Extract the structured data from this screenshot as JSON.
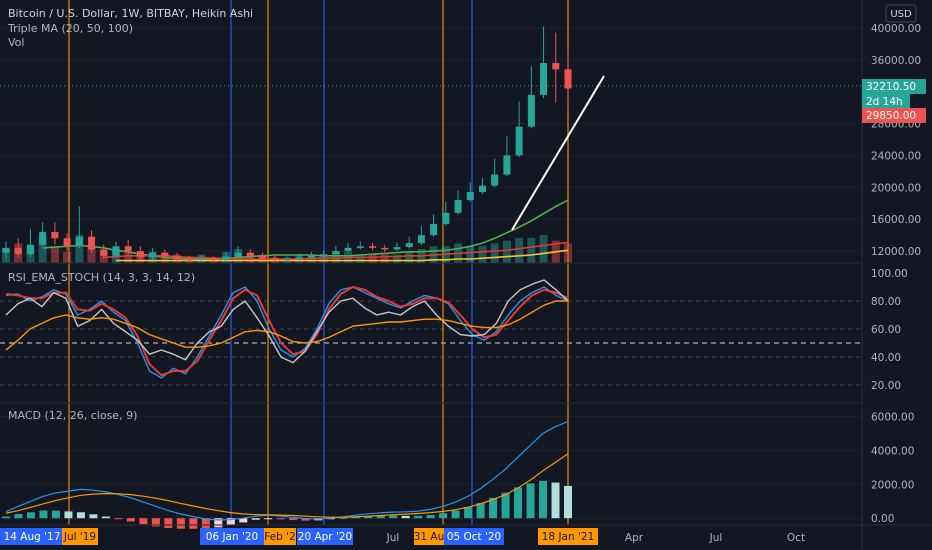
{
  "header": {
    "symbol_title": "Bitcoin / U.S. Dollar, 1W, BITBAY, Heikin Ashi",
    "indicator_ma": "Triple MA (20, 50, 100)",
    "indicator_vol": "Vol",
    "currency": "USD"
  },
  "price_axis": {
    "ticks": [
      "40000.00",
      "36000.00",
      "28000.00",
      "24000.00",
      "20000.00",
      "16000.00",
      "12000.00"
    ],
    "last_price": "32210.50",
    "countdown": "2d 14h",
    "low_marker": "29850.00"
  },
  "rsi_panel": {
    "title": "RSI_EMA_STOCH (14, 3, 3, 14, 12)",
    "ticks": [
      "100.00",
      "80.00",
      "60.00",
      "40.00",
      "20.00"
    ]
  },
  "macd_panel": {
    "title": "MACD (12, 26, close, 9)",
    "ticks": [
      "6000.00",
      "4000.00",
      "2000.00",
      "0.00"
    ]
  },
  "time_axis": {
    "plain_labels": [
      "Jul",
      "Apr",
      "Jul",
      "Oct"
    ],
    "markers": [
      {
        "label": "14 Aug '17",
        "color": "#2962ff"
      },
      {
        "label": "Jul '19",
        "color": "#ff9800"
      },
      {
        "label": "06 Jan '20",
        "color": "#2962ff"
      },
      {
        "label": "Feb '2",
        "color": "#ff9800"
      },
      {
        "label": "20 Apr '20",
        "color": "#2962ff"
      },
      {
        "label": "31 Au",
        "color": "#ff9800"
      },
      {
        "label": "05 Oct '20",
        "color": "#2962ff"
      },
      {
        "label": "18 Jan '21",
        "color": "#ff9800"
      }
    ]
  },
  "colors": {
    "background": "#131722",
    "grid": "#1e222d",
    "up": "#26a69a",
    "down": "#ef5350",
    "orange_marker": "#ff9800",
    "blue_marker": "#2962ff",
    "ma20": "#4caf50",
    "ma50": "#e53935",
    "ma100": "#fbc02d"
  },
  "chart_data": {
    "type": "line",
    "title": "Bitcoin / U.S. Dollar, 1W, BITBAY, Heikin Ashi",
    "price_ylim": [
      10500,
      42000
    ],
    "candles": [
      {
        "o": 11800,
        "c": 12400,
        "h": 13200,
        "l": 11000
      },
      {
        "o": 12400,
        "c": 11600,
        "h": 13600,
        "l": 11200
      },
      {
        "o": 11600,
        "c": 12800,
        "h": 14800,
        "l": 11200
      },
      {
        "o": 12800,
        "c": 14400,
        "h": 15600,
        "l": 12600
      },
      {
        "o": 14400,
        "c": 13600,
        "h": 15600,
        "l": 12800
      },
      {
        "o": 13600,
        "c": 12600,
        "h": 14200,
        "l": 12000
      },
      {
        "o": 12600,
        "c": 13800,
        "h": 17600,
        "l": 12400
      },
      {
        "o": 13800,
        "c": 12200,
        "h": 14600,
        "l": 11800
      },
      {
        "o": 12200,
        "c": 11400,
        "h": 12800,
        "l": 11000
      },
      {
        "o": 11400,
        "c": 12600,
        "h": 13200,
        "l": 11200
      },
      {
        "o": 12600,
        "c": 12000,
        "h": 13400,
        "l": 11600
      },
      {
        "o": 12000,
        "c": 11200,
        "h": 12600,
        "l": 10900
      },
      {
        "o": 11200,
        "c": 11800,
        "h": 12400,
        "l": 10900
      },
      {
        "o": 11800,
        "c": 11400,
        "h": 12200,
        "l": 11000
      },
      {
        "o": 11400,
        "c": 11000,
        "h": 11800,
        "l": 10800
      },
      {
        "o": 11000,
        "c": 10900,
        "h": 11400,
        "l": 10700
      },
      {
        "o": 10900,
        "c": 11100,
        "h": 11500,
        "l": 10700
      },
      {
        "o": 11100,
        "c": 10900,
        "h": 11300,
        "l": 10700
      },
      {
        "o": 10900,
        "c": 11300,
        "h": 11900,
        "l": 10700
      },
      {
        "o": 11300,
        "c": 11800,
        "h": 12600,
        "l": 11100
      },
      {
        "o": 11800,
        "c": 11400,
        "h": 12200,
        "l": 11000
      },
      {
        "o": 11400,
        "c": 11100,
        "h": 11800,
        "l": 10900
      },
      {
        "o": 11100,
        "c": 10900,
        "h": 11500,
        "l": 10700
      },
      {
        "o": 10900,
        "c": 11000,
        "h": 11300,
        "l": 10700
      },
      {
        "o": 11000,
        "c": 11200,
        "h": 11700,
        "l": 10800
      },
      {
        "o": 11200,
        "c": 11400,
        "h": 11900,
        "l": 11000
      },
      {
        "o": 11400,
        "c": 11600,
        "h": 12100,
        "l": 11200
      },
      {
        "o": 11600,
        "c": 12000,
        "h": 12600,
        "l": 11400
      },
      {
        "o": 12000,
        "c": 12400,
        "h": 13000,
        "l": 11800
      },
      {
        "o": 12400,
        "c": 12600,
        "h": 13200,
        "l": 12200
      },
      {
        "o": 12600,
        "c": 12400,
        "h": 13000,
        "l": 12100
      },
      {
        "o": 12400,
        "c": 12200,
        "h": 12800,
        "l": 11900
      },
      {
        "o": 12200,
        "c": 12500,
        "h": 13100,
        "l": 12000
      },
      {
        "o": 12500,
        "c": 13000,
        "h": 13800,
        "l": 12300
      },
      {
        "o": 13000,
        "c": 14000,
        "h": 15200,
        "l": 12800
      },
      {
        "o": 14000,
        "c": 15400,
        "h": 16600,
        "l": 13800
      },
      {
        "o": 15400,
        "c": 16800,
        "h": 18200,
        "l": 15200
      },
      {
        "o": 16800,
        "c": 18400,
        "h": 19600,
        "l": 16600
      },
      {
        "o": 18400,
        "c": 19400,
        "h": 20600,
        "l": 18200
      },
      {
        "o": 19400,
        "c": 20200,
        "h": 21200,
        "l": 19200
      },
      {
        "o": 20200,
        "c": 21600,
        "h": 23600,
        "l": 20000
      },
      {
        "o": 21600,
        "c": 24000,
        "h": 26400,
        "l": 21400
      },
      {
        "o": 24000,
        "c": 27600,
        "h": 30800,
        "l": 23800
      },
      {
        "o": 27600,
        "c": 31600,
        "h": 35200,
        "l": 27400
      },
      {
        "o": 31600,
        "c": 35600,
        "h": 40200,
        "l": 31200
      },
      {
        "o": 35600,
        "c": 34800,
        "h": 39400,
        "l": 30600
      },
      {
        "o": 34800,
        "c": 32400,
        "h": 37200,
        "l": 29800
      }
    ],
    "moving_averages": [
      {
        "name": "MA 20",
        "values": [
          12400,
          12500,
          12600,
          12700,
          12600,
          12400,
          12100,
          11900,
          11600,
          11400,
          11200,
          11100,
          11000,
          11000,
          11000,
          11100,
          11200,
          11300,
          11400,
          11500,
          11500,
          11500,
          11500,
          11400,
          11400,
          11400,
          11500,
          11600,
          11700,
          11800,
          11900,
          11900,
          12000,
          12100,
          12300,
          12600,
          13000,
          13600,
          14300,
          15000,
          15800,
          16700,
          17600,
          18400
        ]
      },
      {
        "name": "MA 50",
        "values": [
          11200,
          11300,
          11400,
          11400,
          11400,
          11400,
          11300,
          11200,
          11200,
          11100,
          11100,
          11000,
          11000,
          11000,
          11000,
          11000,
          11000,
          11100,
          11100,
          11100,
          11200,
          11200,
          11200,
          11300,
          11300,
          11400,
          11400,
          11500,
          11600,
          11700,
          11800,
          11900,
          12000,
          12100,
          12300,
          12500,
          12700,
          12900,
          13100
        ]
      },
      {
        "name": "MA 100",
        "values": [
          10800,
          10800,
          10800,
          10800,
          10800,
          10800,
          10800,
          10800,
          10800,
          10800,
          10800,
          10800,
          10800,
          10800,
          10800,
          10800,
          10800,
          10800,
          10800,
          10800,
          10800,
          10800,
          10800,
          10800,
          10800,
          10800,
          10900,
          10900,
          11000,
          11000,
          11100,
          11200,
          11300,
          11400,
          11500,
          11700,
          11900,
          12100
        ]
      }
    ],
    "volume": [
      0.5,
      0.7,
      0.6,
      0.9,
      0.6,
      0.4,
      1.0,
      0.6,
      0.4,
      0.5,
      0.4,
      0.3,
      0.4,
      0.3,
      0.3,
      0.2,
      0.3,
      0.2,
      0.4,
      0.5,
      0.3,
      0.3,
      0.2,
      0.2,
      0.3,
      0.3,
      0.3,
      0.4,
      0.4,
      0.3,
      0.3,
      0.3,
      0.3,
      0.4,
      0.5,
      0.6,
      0.6,
      0.7,
      0.6,
      0.6,
      0.7,
      0.8,
      0.9,
      0.9,
      1.0,
      0.8,
      0.7
    ],
    "rsi_ylim": [
      10,
      100
    ],
    "rsi_series": [
      {
        "name": "stoch_k",
        "values": [
          84,
          85,
          80,
          83,
          88,
          85,
          70,
          74,
          80,
          72,
          66,
          50,
          30,
          25,
          32,
          28,
          40,
          55,
          70,
          86,
          90,
          80,
          60,
          45,
          40,
          46,
          60,
          78,
          88,
          90,
          86,
          82,
          78,
          75,
          80,
          84,
          82,
          78,
          66,
          56,
          52,
          58,
          70,
          80,
          86,
          90,
          84,
          80
        ]
      },
      {
        "name": "stoch_d",
        "values": [
          85,
          84,
          82,
          82,
          86,
          86,
          74,
          73,
          78,
          74,
          68,
          55,
          35,
          27,
          30,
          30,
          37,
          52,
          66,
          82,
          88,
          84,
          66,
          50,
          42,
          44,
          56,
          74,
          85,
          90,
          88,
          83,
          80,
          76,
          78,
          82,
          82,
          79,
          70,
          60,
          54,
          56,
          66,
          76,
          84,
          88,
          86,
          82
        ]
      },
      {
        "name": "rsi",
        "values": [
          70,
          78,
          82,
          76,
          86,
          82,
          62,
          66,
          74,
          64,
          58,
          52,
          42,
          45,
          42,
          38,
          50,
          58,
          62,
          74,
          80,
          68,
          55,
          40,
          36,
          44,
          58,
          72,
          80,
          82,
          75,
          70,
          72,
          70,
          76,
          80,
          70,
          62,
          56,
          55,
          56,
          64,
          80,
          88,
          92,
          95,
          88,
          80
        ]
      },
      {
        "name": "rsi_ema",
        "values": [
          45,
          52,
          60,
          64,
          68,
          70,
          68,
          67,
          68,
          67,
          64,
          61,
          56,
          53,
          50,
          47,
          47,
          48,
          50,
          54,
          58,
          59,
          58,
          55,
          51,
          50,
          51,
          54,
          58,
          62,
          63,
          64,
          65,
          65,
          66,
          67,
          67,
          66,
          64,
          62,
          61,
          61,
          63,
          67,
          72,
          77,
          80,
          80
        ]
      }
    ],
    "macd_ylim": [
      -400,
      6200
    ],
    "macd_series": [
      {
        "name": "macd",
        "values": [
          400,
          700,
          1000,
          1300,
          1500,
          1600,
          1700,
          1650,
          1550,
          1400,
          1200,
          950,
          700,
          450,
          250,
          100,
          -50,
          -100,
          -80,
          0,
          120,
          180,
          120,
          50,
          -20,
          -40,
          0,
          80,
          180,
          260,
          320,
          360,
          380,
          420,
          520,
          700,
          950,
          1300,
          1750,
          2300,
          2900,
          3600,
          4300,
          5000,
          5400,
          5700
        ]
      },
      {
        "name": "signal",
        "values": [
          300,
          450,
          650,
          850,
          1050,
          1200,
          1350,
          1420,
          1450,
          1440,
          1390,
          1300,
          1180,
          1030,
          870,
          720,
          570,
          440,
          330,
          250,
          210,
          200,
          185,
          160,
          120,
          85,
          60,
          60,
          80,
          120,
          160,
          200,
          240,
          280,
          330,
          400,
          500,
          650,
          850,
          1100,
          1400,
          1780,
          2250,
          2800,
          3300,
          3800
        ]
      }
    ],
    "macd_hist": [
      100,
      250,
      350,
      450,
      450,
      400,
      350,
      230,
      100,
      -40,
      -190,
      -350,
      -480,
      -580,
      -620,
      -620,
      -620,
      -540,
      -410,
      -250,
      -90,
      -20,
      -65,
      -110,
      -140,
      -125,
      -60,
      20,
      100,
      140,
      160,
      160,
      140,
      140,
      190,
      300,
      450,
      650,
      900,
      1200,
      1500,
      1820,
      2050,
      2200,
      2100,
      1900
    ]
  }
}
